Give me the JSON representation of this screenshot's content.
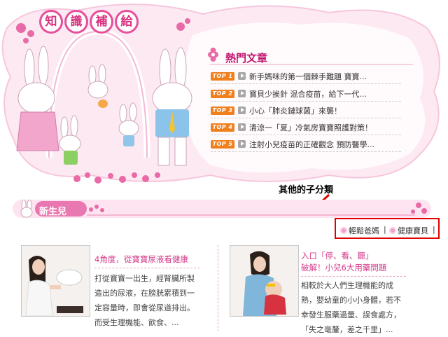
{
  "header": {
    "title_chars": [
      "知",
      "識",
      "補",
      "給"
    ]
  },
  "hot": {
    "title": "熱門文章",
    "items": [
      {
        "rank": "TOP 1",
        "text": "新手媽咪的第一個棘手難題 寶寶..."
      },
      {
        "rank": "TOP 2",
        "text": "寶貝少挨針 混合疫苗，給下一代..."
      },
      {
        "rank": "TOP 3",
        "text": "小心「肺炎鏈球菌」來襲！"
      },
      {
        "rank": "TOP 4",
        "text": "清涼一「夏」冷氣房寶寶照護對策！"
      },
      {
        "rank": "TOP 5",
        "text": "注射小兒疫苗的正確觀念 預防醫學..."
      }
    ]
  },
  "annotation": {
    "label": "其他的子分類"
  },
  "section": {
    "title": "新生兒"
  },
  "subcategories": {
    "items": [
      {
        "label": "輕鬆爸媽"
      },
      {
        "label": "健康寶貝"
      }
    ],
    "separator": "|"
  },
  "articles": [
    {
      "title": "4角度，從寶寶尿液看健康",
      "body_lines": [
        "打從寶寶一出生，經腎臟所製",
        "造出的尿液，在膀胱累積到一",
        "定容量時，即會從尿道排出。",
        "而受生理機能、飲食、..."
      ]
    },
    {
      "title_lines": [
        "入口「停、看、聽」",
        "破解！小兒6大用藥問題"
      ],
      "body_lines": [
        "相較於大人們生理機能的成",
        "熟，嬰幼童的小小身體，若不",
        "幸發生服藥過量、誤食處方，",
        "「失之毫釐，差之千里」..."
      ]
    }
  ],
  "colors": {
    "accent_pink": "#e64f9b",
    "title_pink": "#c01870",
    "top_tag": "#f07f1e",
    "annotation_red": "#e00000"
  }
}
